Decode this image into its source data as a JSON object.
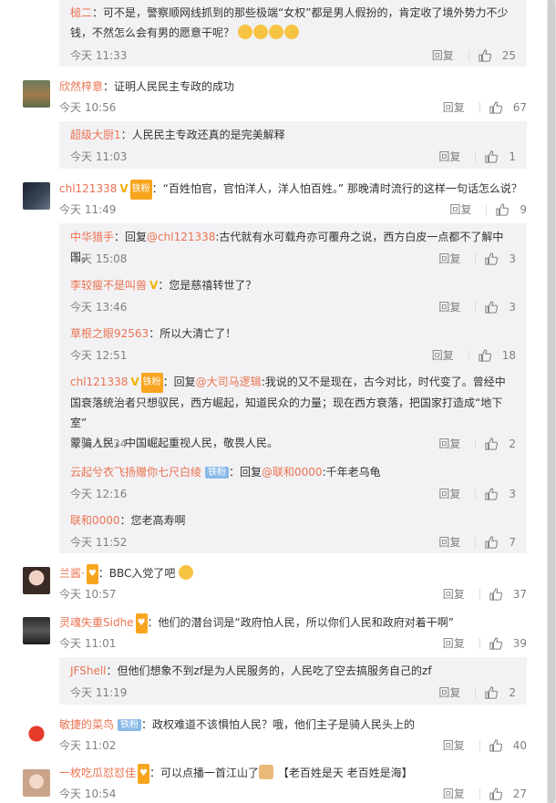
{
  "labels": {
    "reply": "回复"
  },
  "colors": {
    "name": "#eb7350",
    "meta": "#808080",
    "reply_bg": "#f2f2f5"
  },
  "comments": [
    {
      "text_lines": [
        "：可不是，警察顺网线抓到的那些极端“女权”都是男人假扮的，肯定收了境外势力不少",
        "钱，不然怎么会有男的愿意干呢？"
      ],
      "user": "槌二",
      "time": "今天 11:33",
      "likes": "25"
    },
    {
      "user": "欣然梓意",
      "text": "：证明人民民主专政的成功",
      "time": "今天 10:56",
      "likes": "67"
    },
    {
      "user": "超级大厨1",
      "text": "：人民民主专政还真的是完美解释",
      "time": "今天 11:03",
      "likes": "1"
    },
    {
      "user": "chl121338",
      "badge": "铁粉",
      "text": "：“百姓怕官，官怕洋人，洋人怕百姓。” 那晚清时流行的这样一句话怎么说？",
      "time": "今天 11:49",
      "likes": "9"
    },
    {
      "user": "中华猎手",
      "reply_prefix": "：回复",
      "at": "@chl121338",
      "text": ":古代就有水可载舟亦可覆舟之说，西方白皮一点都不了解中国。",
      "time": "今天 15:08",
      "likes": "3"
    },
    {
      "user": "李较瘦不是叫兽",
      "text": "：您是慈禧转世了？",
      "time": "今天 13:46",
      "likes": "3"
    },
    {
      "user": "草根之眼92563",
      "text": "：所以大清亡了！",
      "time": "今天 12:51",
      "likes": "18"
    },
    {
      "user": "chl121338",
      "badge": "铁粉",
      "reply_prefix": "：回复",
      "at": "@大司马逻辑",
      "text": ":我说的又不是现在，古今对比，时代变了。曾经中",
      "text_lines": [
        "国衰落统治者只想驭民，西方崛起，知道民众的力量；现在西方衰落，把国家打造成“地下室”",
        "蒙骗人民，中国崛起重视人民，敬畏人民。"
      ],
      "time": "今天 12:34",
      "likes": "2"
    },
    {
      "user": "云起兮衣飞扬赠你七尺白绫",
      "badge": "铁粉",
      "reply_prefix": "：回复",
      "at": "@联和0000",
      "text": ":千年老乌龟",
      "time": "今天 12:16",
      "likes": "3"
    },
    {
      "user": "联和0000",
      "text": "：您老高寿啊",
      "time": "今天 11:52",
      "likes": "7"
    },
    {
      "user": "兰酱·",
      "text": "：BBC入党了吧",
      "time": "今天 10:57",
      "likes": "37"
    },
    {
      "user": "灵魂失重Sidhe",
      "text": "：他们的潜台词是“政府怕人民，所以你们人民和政府对着干啊”",
      "time": "今天 11:01",
      "likes": "39"
    },
    {
      "user": "JFShell",
      "text": "：但他们想象不到zf是为人民服务的，人民吃了空去搞服务自己的zf",
      "time": "今天 11:19",
      "likes": "2"
    },
    {
      "user": "敏捷的菜鸟",
      "badge": "铁粉",
      "text": "：政权难道不该惧怕人民？哦，他们主子是骑人民头上的",
      "time": "今天 11:02",
      "likes": "40"
    },
    {
      "user": "一枚吃瓜怼怼佳",
      "text": "：可以点播一首江山了",
      "text2": "【老百姓是天 老百姓是海】",
      "time": "今天 10:54",
      "likes": "27"
    }
  ]
}
